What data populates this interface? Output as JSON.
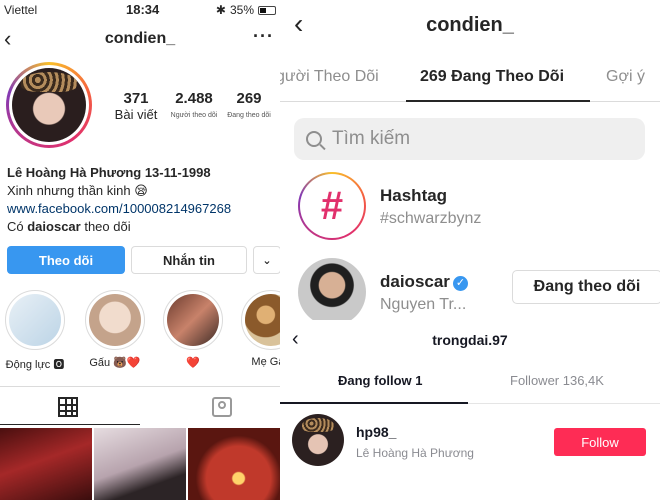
{
  "left": {
    "status": {
      "carrier": "Viettel",
      "time": "18:34",
      "battery": "35%",
      "battery_level": 0.35
    },
    "header": {
      "back": "‹",
      "username": "condien_",
      "more": "···"
    },
    "stats": [
      {
        "number": "371",
        "label": "Bài viết"
      },
      {
        "number": "2.488",
        "label": "Người theo dõi"
      },
      {
        "number": "269",
        "label": "Đang theo dõi"
      }
    ],
    "bio": {
      "name": "Lê Hoàng Hà Phương 13-11-1998",
      "line1": "Xinh nhưng thần kinh 😪",
      "link": "www.facebook.com/100008214967268",
      "followed_by_prefix": "Có ",
      "followed_by_user": "daioscar",
      "followed_by_suffix": " theo dõi"
    },
    "buttons": {
      "follow": "Theo dõi",
      "message": "Nhắn tin",
      "dropdown": "⌄"
    },
    "highlights": [
      {
        "label": "Động lực 🅾",
        "color": "#cfe2ef"
      },
      {
        "label": "Gấu 🐻❤️",
        "color": "#d9c3b0"
      },
      {
        "label": "❤️",
        "color": "#8b5a4a"
      },
      {
        "label": "Mẹ Gấu",
        "color": "#b58a5d"
      }
    ],
    "photos": [
      "#7a1f1f",
      "#c9b8c0",
      "#b33a2a"
    ]
  },
  "right_top": {
    "header": {
      "back": "‹",
      "username": "condien_"
    },
    "tabs": [
      {
        "label": "gười Theo Dõi"
      },
      {
        "label": "269 Đang Theo Dõi"
      },
      {
        "label": "Gợi ý"
      }
    ],
    "search_placeholder": "Tìm kiếm",
    "rows": [
      {
        "title": "Hashtag",
        "subtitle": "#schwarzbynz",
        "icon": "#"
      },
      {
        "title": "daioscar",
        "subtitle": "Nguyen Tr...",
        "button": "Đang theo dõi"
      }
    ]
  },
  "right_bottom": {
    "header": {
      "back": "‹",
      "username": "trongdai.97"
    },
    "tabs": [
      {
        "label": "Đang follow 1"
      },
      {
        "label": "Follower 136,4K"
      }
    ],
    "row": {
      "title": "hp98_",
      "subtitle": "Lê Hoàng Hà Phương",
      "button": "Follow"
    }
  }
}
